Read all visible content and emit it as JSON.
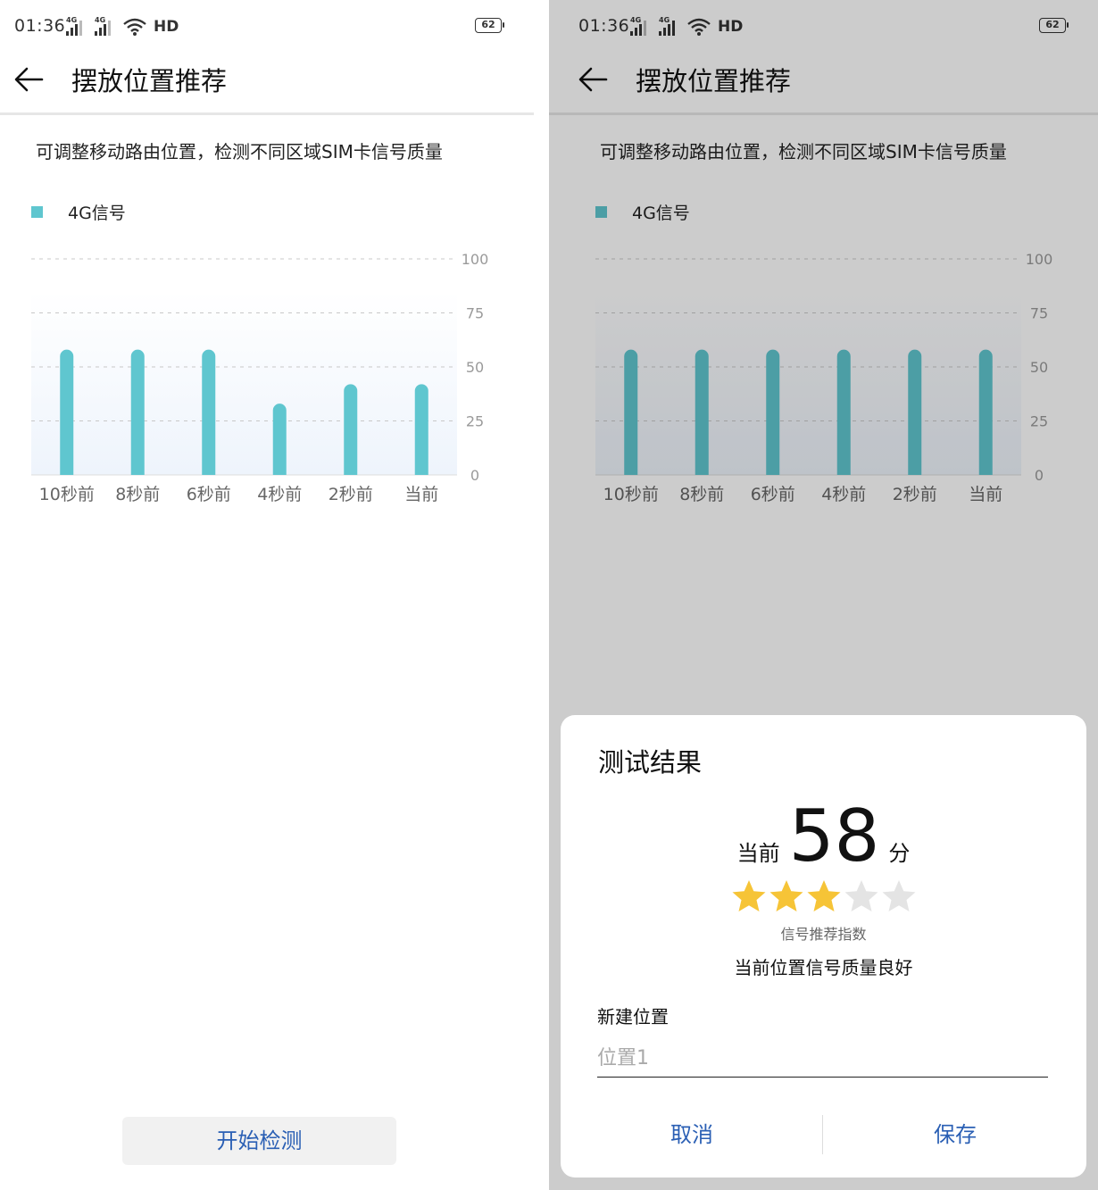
{
  "status": {
    "time": "01:36",
    "network_tag": "4G",
    "network_type": "HD",
    "battery": "62"
  },
  "app": {
    "title": "摆放位置推荐",
    "subtitle": "可调整移动路由位置，检测不同区域SIM卡信号质量",
    "legend_label": "4G信号",
    "start_button": "开始检测"
  },
  "colors": {
    "bar": "#5fc6cf",
    "bar_dimmed": "#4ba0a6",
    "accent_text": "#2a5fb4",
    "star_filled": "#f6c437",
    "star_empty": "#e4e4e4"
  },
  "chart_data": [
    {
      "type": "bar",
      "categories": [
        "10秒前",
        "8秒前",
        "6秒前",
        "4秒前",
        "2秒前",
        "当前"
      ],
      "series": [
        {
          "name": "4G信号",
          "values": [
            58,
            58,
            58,
            33,
            42,
            42
          ]
        }
      ],
      "y_ticks": [
        "0",
        "25",
        "50",
        "75",
        "100"
      ],
      "ylim": [
        0,
        100
      ],
      "grid": true,
      "legend": "top-left"
    },
    {
      "type": "bar",
      "categories": [
        "10秒前",
        "8秒前",
        "6秒前",
        "4秒前",
        "2秒前",
        "当前"
      ],
      "series": [
        {
          "name": "4G信号",
          "values": [
            58,
            58,
            58,
            58,
            58,
            58
          ]
        }
      ],
      "y_ticks": [
        "0",
        "25",
        "50",
        "75",
        "100"
      ],
      "ylim": [
        0,
        100
      ],
      "grid": true,
      "legend": "top-left"
    }
  ],
  "dialog": {
    "title": "测试结果",
    "score_prefix": "当前",
    "score": "58",
    "score_unit": "分",
    "stars_filled": 3,
    "stars_total": 5,
    "star_caption": "信号推荐指数",
    "verdict": "当前位置信号质量良好",
    "field_label": "新建位置",
    "field_placeholder": "位置1",
    "cancel": "取消",
    "save": "保存"
  }
}
